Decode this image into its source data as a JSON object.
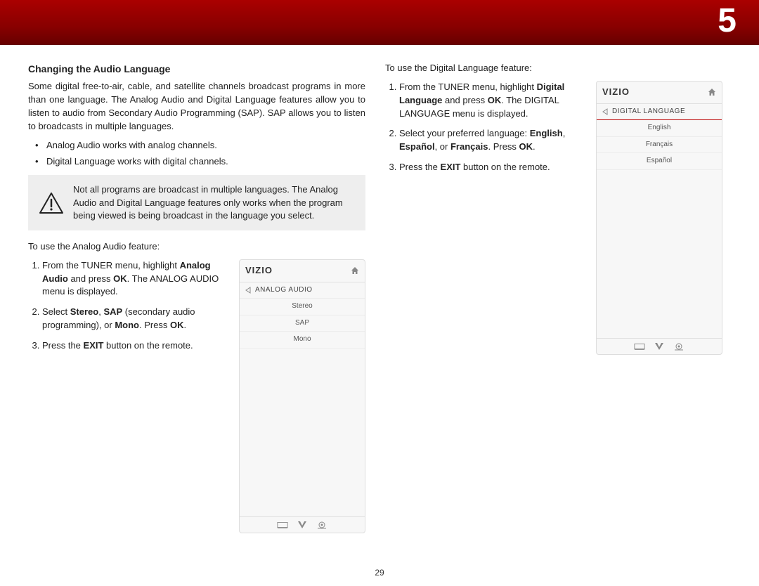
{
  "chapter": "5",
  "page_number": "29",
  "logo_text": "VIZIO",
  "left": {
    "heading": "Changing the Audio Language",
    "intro": "Some digital free-to-air, cable, and satellite channels broadcast programs in more than one language. The Analog Audio and Digital Language features allow you to listen to audio from Secondary Audio Programming (SAP). SAP allows you to listen to broadcasts in multiple languages.",
    "bullet1": "Analog Audio works with analog channels.",
    "bullet2": "Digital Language works with digital channels.",
    "note": "Not all programs are broadcast in multiple languages. The Analog Audio and Digital Language features only works when the program being viewed is being broadcast in the language you select.",
    "use_intro": "To use the Analog Audio feature:",
    "s1a": "From the TUNER menu, highlight ",
    "s1b": "Analog Audio",
    "s1c": " and press ",
    "s1d": "OK",
    "s1e": ". The ANALOG AUDIO menu is displayed.",
    "s2a": "Select ",
    "s2b": "Stereo",
    "s2c": ", ",
    "s2d": "SAP",
    "s2e": " (secondary audio programming), or ",
    "s2f": "Mono",
    "s2g": ". Press ",
    "s2h": "OK",
    "s2i": ".",
    "s3a": "Press the ",
    "s3b": "EXIT",
    "s3c": " button on the remote.",
    "menu_title": "ANALOG AUDIO",
    "opt1": "Stereo",
    "opt2": "SAP",
    "opt3": "Mono"
  },
  "right": {
    "use_intro": "To use the Digital Language feature:",
    "s1a": "From the TUNER menu, highlight ",
    "s1b": "Digital Language",
    "s1c": " and press ",
    "s1d": "OK",
    "s1e": ". The DIGITAL LANGUAGE menu is displayed.",
    "s2a": "Select your preferred language: ",
    "s2b": "English",
    "s2c": ", ",
    "s2d": "Español",
    "s2e": ", or ",
    "s2f": "Français",
    "s2g": ". Press ",
    "s2h": "OK",
    "s2i": ".",
    "s3a": "Press the ",
    "s3b": "EXIT",
    "s3c": " button on the remote.",
    "menu_title": "DIGITAL LANGUAGE",
    "opt1": "English",
    "opt2": "Français",
    "opt3": "Español"
  }
}
